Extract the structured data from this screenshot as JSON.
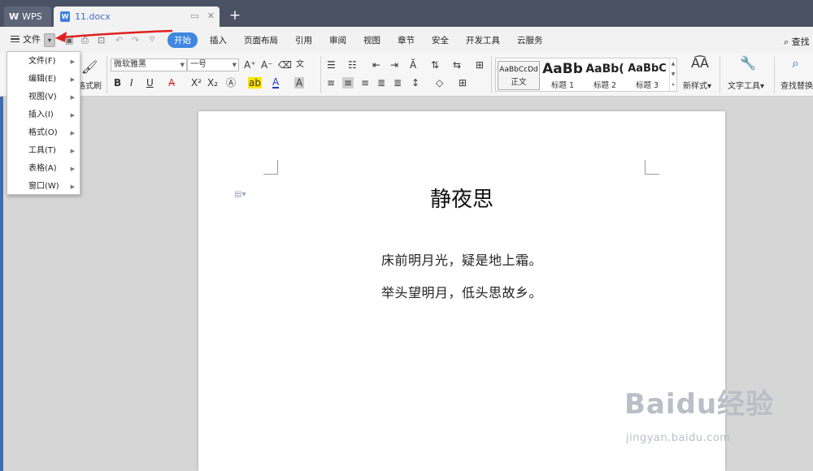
{
  "titlebar": {
    "app_tab_label": "WPS",
    "doc_tab_label": "11.docx",
    "new_tab_glyph": "+",
    "close_glyph": "✕",
    "pin_glyph": "▭"
  },
  "menu": {
    "file_label": "文件",
    "tabs": [
      "开始",
      "插入",
      "页面布局",
      "引用",
      "审阅",
      "视图",
      "章节",
      "安全",
      "开发工具",
      "云服务"
    ],
    "search_label": "查找"
  },
  "file_menu_items": [
    "文件(F)",
    "编辑(E)",
    "视图(V)",
    "插入(I)",
    "格式(O)",
    "工具(T)",
    "表格(A)",
    "窗口(W)"
  ],
  "ribbon": {
    "format_painter_label": "格式刷",
    "font_name": "微软雅黑",
    "font_size": "一号",
    "styles": [
      {
        "preview": "AaBbCcDd",
        "label": "正文"
      },
      {
        "preview": "AaBb",
        "label": "标题 1"
      },
      {
        "preview": "AaBb(",
        "label": "标题 2"
      },
      {
        "preview": "AaBbC",
        "label": "标题 3"
      }
    ],
    "new_style_label": "新样式",
    "text_tools_label": "文字工具",
    "find_replace_label": "查找替换"
  },
  "document": {
    "title": "静夜思",
    "lines": [
      "床前明月光，疑是地上霜。",
      "举头望明月，低头思故乡。"
    ]
  },
  "watermark": {
    "brand": "Baidu经验",
    "url": "jingyan.baidu.com"
  },
  "colors": {
    "titlebar_bg": "#4a5263",
    "accent_tab": "#3f87e0",
    "annotation_arrow": "#e02020"
  }
}
